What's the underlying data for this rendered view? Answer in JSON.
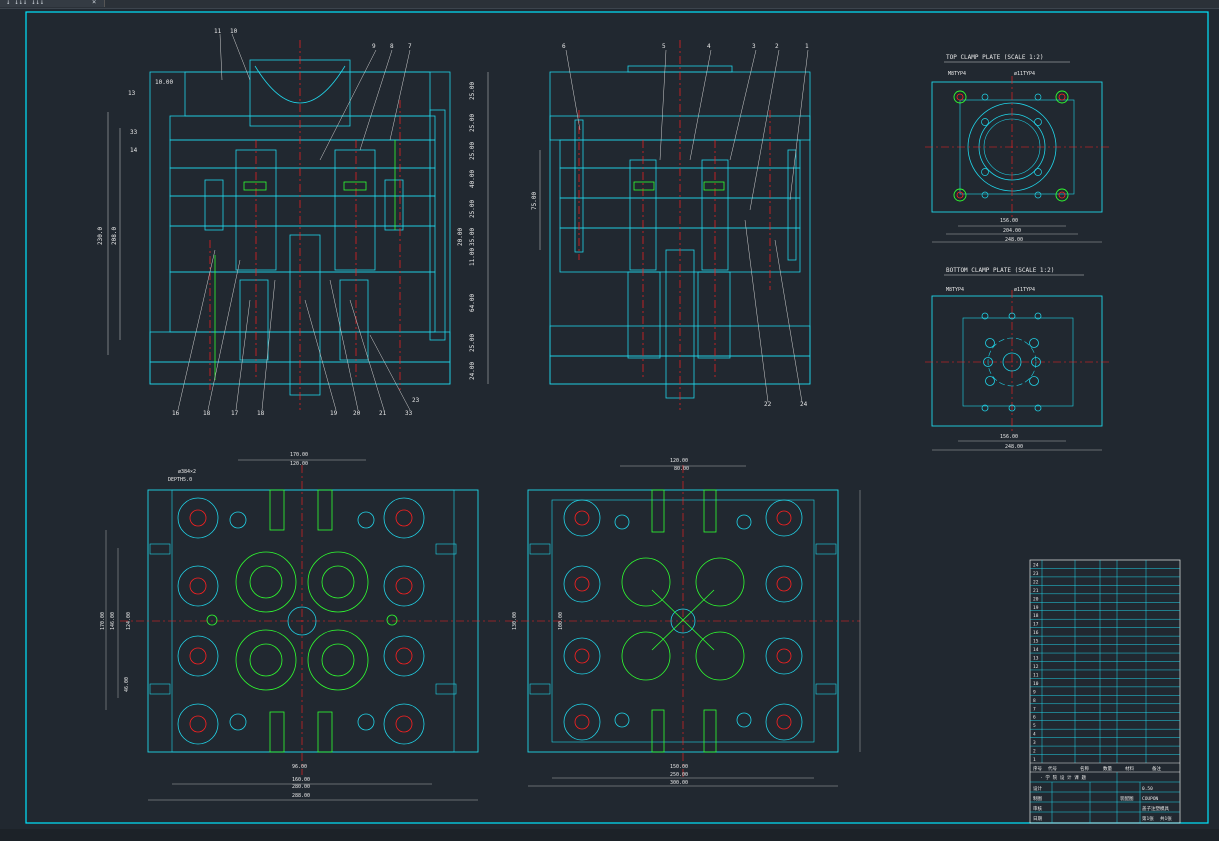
{
  "app": {
    "tab_label": "↓ ↓↓↓ ↓↓↓",
    "tab_close": "×"
  },
  "colors": {
    "background": "#212830",
    "frame": "#00e5ff",
    "plate": "#21d4e8",
    "centerline": "#ff2020",
    "detail": "#30ff30",
    "text": "#e8e8e8",
    "dimension": "#c8c8c8"
  },
  "views": {
    "top_clamp_title": "TOP CLAMP PLATE  (SCALE 1:2)",
    "bottom_clamp_title": "BOTTOM CLAMP PLATE  (SCALE 1:2)",
    "top_dims": [
      "156.00",
      "204.00",
      "248.00"
    ],
    "bottom_dims": [
      "156.00",
      "248.00"
    ],
    "top_hole_labels": [
      "M8TYP4",
      "ø11TYP4"
    ],
    "bottom_hole_labels": [
      "M8TYP4",
      "ø11TYP4"
    ]
  },
  "section_left": {
    "part_numbers_top": [
      "11",
      "10",
      "9",
      "8",
      "7"
    ],
    "part_numbers_left": [
      "13",
      "33",
      "14"
    ],
    "part_numbers_bottom": [
      "16",
      "18",
      "17",
      "18",
      "19",
      "20",
      "21",
      "33",
      "23"
    ],
    "dims_right": [
      "25.00",
      "25.00",
      "25.00",
      "40.00",
      "25.00",
      "35.00",
      "11.00",
      "20.00",
      "64.00",
      "25.00",
      "24.00"
    ],
    "dims_left": [
      "230.0",
      "208.0",
      "10.00"
    ]
  },
  "section_right": {
    "part_numbers_top": [
      "6",
      "5",
      "4",
      "3",
      "2",
      "1"
    ],
    "part_numbers_bottom": [
      "22",
      "24"
    ],
    "dims_left": [
      "75.00"
    ]
  },
  "plan_left": {
    "dims_top": [
      "170.00",
      "120.00"
    ],
    "dims_bottom": [
      "96.00",
      "160.00",
      "280.00",
      "288.00"
    ],
    "dims_left": [
      "170.00",
      "146.00",
      "124.00",
      "46.00"
    ],
    "note": [
      "ø384×2",
      "DEPTH5.0"
    ]
  },
  "plan_right": {
    "dims_top": [
      "120.00",
      "80.00"
    ],
    "dims_bottom": [
      "150.00",
      "250.00",
      "300.00"
    ],
    "dims_left": [
      "130.00",
      "100.00"
    ]
  },
  "title_block": {
    "row_numbers": [
      "24",
      "23",
      "22",
      "21",
      "20",
      "19",
      "18",
      "17",
      "16",
      "15",
      "14",
      "13",
      "12",
      "11",
      "10",
      "9",
      "8",
      "7",
      "6",
      "5",
      "4",
      "3",
      "2",
      "1"
    ],
    "header_cells": [
      "序号",
      "代号",
      "名称",
      "数量",
      "材料",
      "备注"
    ],
    "school_line": "· 学 院 设 计 课 题",
    "label_rows": [
      "设计",
      "制图",
      "审核",
      "日期"
    ],
    "values": [
      "0.50",
      "COUPON",
      "盖子注塑模具",
      "装配图",
      "第1张",
      "共1张"
    ]
  },
  "status": {
    "text": ""
  }
}
